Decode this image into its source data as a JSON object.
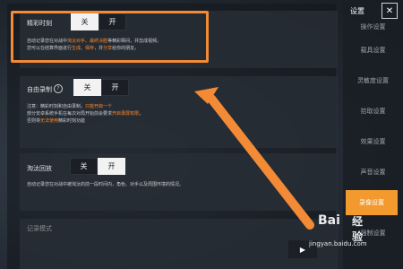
{
  "sidebar": {
    "title": "设置",
    "close_icon": "close-icon",
    "items": [
      {
        "label": "操作设置",
        "active": false
      },
      {
        "label": "载具设置",
        "active": false
      },
      {
        "label": "灵敏度设置",
        "active": false
      },
      {
        "label": "拾取设置",
        "active": false
      },
      {
        "label": "效果设置",
        "active": false
      },
      {
        "label": "声音设置",
        "active": false
      },
      {
        "label": "录像设置",
        "active": true
      },
      {
        "label": "强制设置",
        "active": false
      }
    ]
  },
  "sections": [
    {
      "title": "精彩时刻",
      "toggle": {
        "off_label": "关",
        "on_label": "开",
        "selected": "off"
      },
      "desc_lines": [
        [
          {
            "t": "自动记录您在对战中"
          },
          {
            "t": "淘汰对手",
            "hl": true
          },
          {
            "t": "、"
          },
          {
            "t": "最终决胜",
            "hl": true
          },
          {
            "t": "等精彩瞬间，并剪成视频。"
          }
        ],
        [
          {
            "t": "您可以在结算界面进行"
          },
          {
            "t": "生成",
            "hl": true
          },
          {
            "t": "、"
          },
          {
            "t": "保存",
            "hl": true
          },
          {
            "t": "，并"
          },
          {
            "t": "分享",
            "hl": true
          },
          {
            "t": "给你的朋友。"
          }
        ]
      ]
    },
    {
      "title": "自由录制",
      "help_icon": "question-icon",
      "toggle": {
        "off_label": "关",
        "on_label": "开",
        "selected": "off"
      },
      "desc_lines": [
        [
          {
            "t": "注意：精彩时刻和自由录制，"
          },
          {
            "t": "只能开启一个",
            "hl": true
          }
        ],
        [
          {
            "t": "部分安卓系统手机在每次对局开始前会要求"
          },
          {
            "t": "开启录屏权限",
            "hl": true
          },
          {
            "t": "，"
          }
        ],
        [
          {
            "t": "否则将"
          },
          {
            "t": "无法使用",
            "hl": true
          },
          {
            "t": "精彩时刻功能"
          }
        ]
      ]
    },
    {
      "title": "淘汰回放",
      "toggle": {
        "off_label": "关",
        "on_label": "开",
        "selected": "on"
      },
      "desc_lines": [
        [
          {
            "t": "自动记录您在对战中被淘汰的前一段时间内，角色、对手以及周围环境的情况。"
          }
        ]
      ]
    },
    {
      "title": "记录模式"
    }
  ],
  "watermark": {
    "logo": "Bai",
    "logo2": "经验",
    "url": "jingyan.baidu.com"
  },
  "overlay_icon": "video-icon"
}
